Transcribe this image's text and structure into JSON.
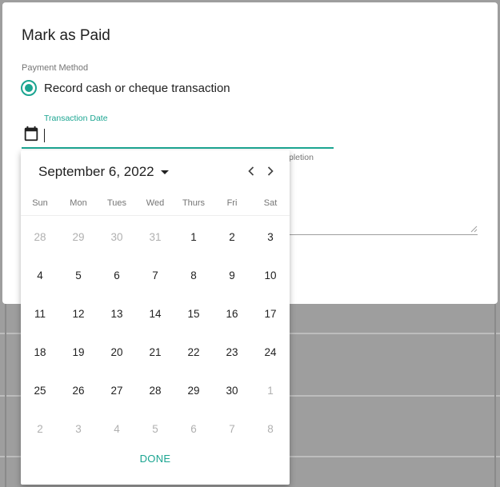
{
  "dialog": {
    "title": "Mark as Paid",
    "payment_method_label": "Payment Method",
    "payment_option": "Record cash or cheque transaction",
    "field_label": "Transaction Date",
    "field_value": "",
    "helper_text_fragment": "pletion"
  },
  "picker": {
    "month_label": "September 6, 2022",
    "weekdays": [
      "Sun",
      "Mon",
      "Tues",
      "Wed",
      "Thurs",
      "Fri",
      "Sat"
    ],
    "weeks": [
      [
        {
          "d": "28",
          "m": true
        },
        {
          "d": "29",
          "m": true
        },
        {
          "d": "30",
          "m": true
        },
        {
          "d": "31",
          "m": true
        },
        {
          "d": "1",
          "m": false
        },
        {
          "d": "2",
          "m": false
        },
        {
          "d": "3",
          "m": false
        }
      ],
      [
        {
          "d": "4",
          "m": false
        },
        {
          "d": "5",
          "m": false
        },
        {
          "d": "6",
          "m": false
        },
        {
          "d": "7",
          "m": false
        },
        {
          "d": "8",
          "m": false
        },
        {
          "d": "9",
          "m": false
        },
        {
          "d": "10",
          "m": false
        }
      ],
      [
        {
          "d": "11",
          "m": false
        },
        {
          "d": "12",
          "m": false
        },
        {
          "d": "13",
          "m": false
        },
        {
          "d": "14",
          "m": false
        },
        {
          "d": "15",
          "m": false
        },
        {
          "d": "16",
          "m": false
        },
        {
          "d": "17",
          "m": false
        }
      ],
      [
        {
          "d": "18",
          "m": false
        },
        {
          "d": "19",
          "m": false
        },
        {
          "d": "20",
          "m": false
        },
        {
          "d": "21",
          "m": false
        },
        {
          "d": "22",
          "m": false
        },
        {
          "d": "23",
          "m": false
        },
        {
          "d": "24",
          "m": false
        }
      ],
      [
        {
          "d": "25",
          "m": false
        },
        {
          "d": "26",
          "m": false
        },
        {
          "d": "27",
          "m": false
        },
        {
          "d": "28",
          "m": false
        },
        {
          "d": "29",
          "m": false
        },
        {
          "d": "30",
          "m": false
        },
        {
          "d": "1",
          "m": true
        }
      ],
      [
        {
          "d": "2",
          "m": true
        },
        {
          "d": "3",
          "m": true
        },
        {
          "d": "4",
          "m": true
        },
        {
          "d": "5",
          "m": true
        },
        {
          "d": "6",
          "m": true
        },
        {
          "d": "7",
          "m": true
        },
        {
          "d": "8",
          "m": true
        }
      ]
    ],
    "done_label": "DONE"
  },
  "icons": {
    "calendar": "calendar-icon",
    "prev": "chevron-left-icon",
    "next": "chevron-right-icon",
    "dropdown": "caret-down-icon"
  },
  "colors": {
    "accent": "#1ba591",
    "text": "#212121",
    "muted": "#b0b0b0",
    "backdrop": "#9e9e9e"
  }
}
